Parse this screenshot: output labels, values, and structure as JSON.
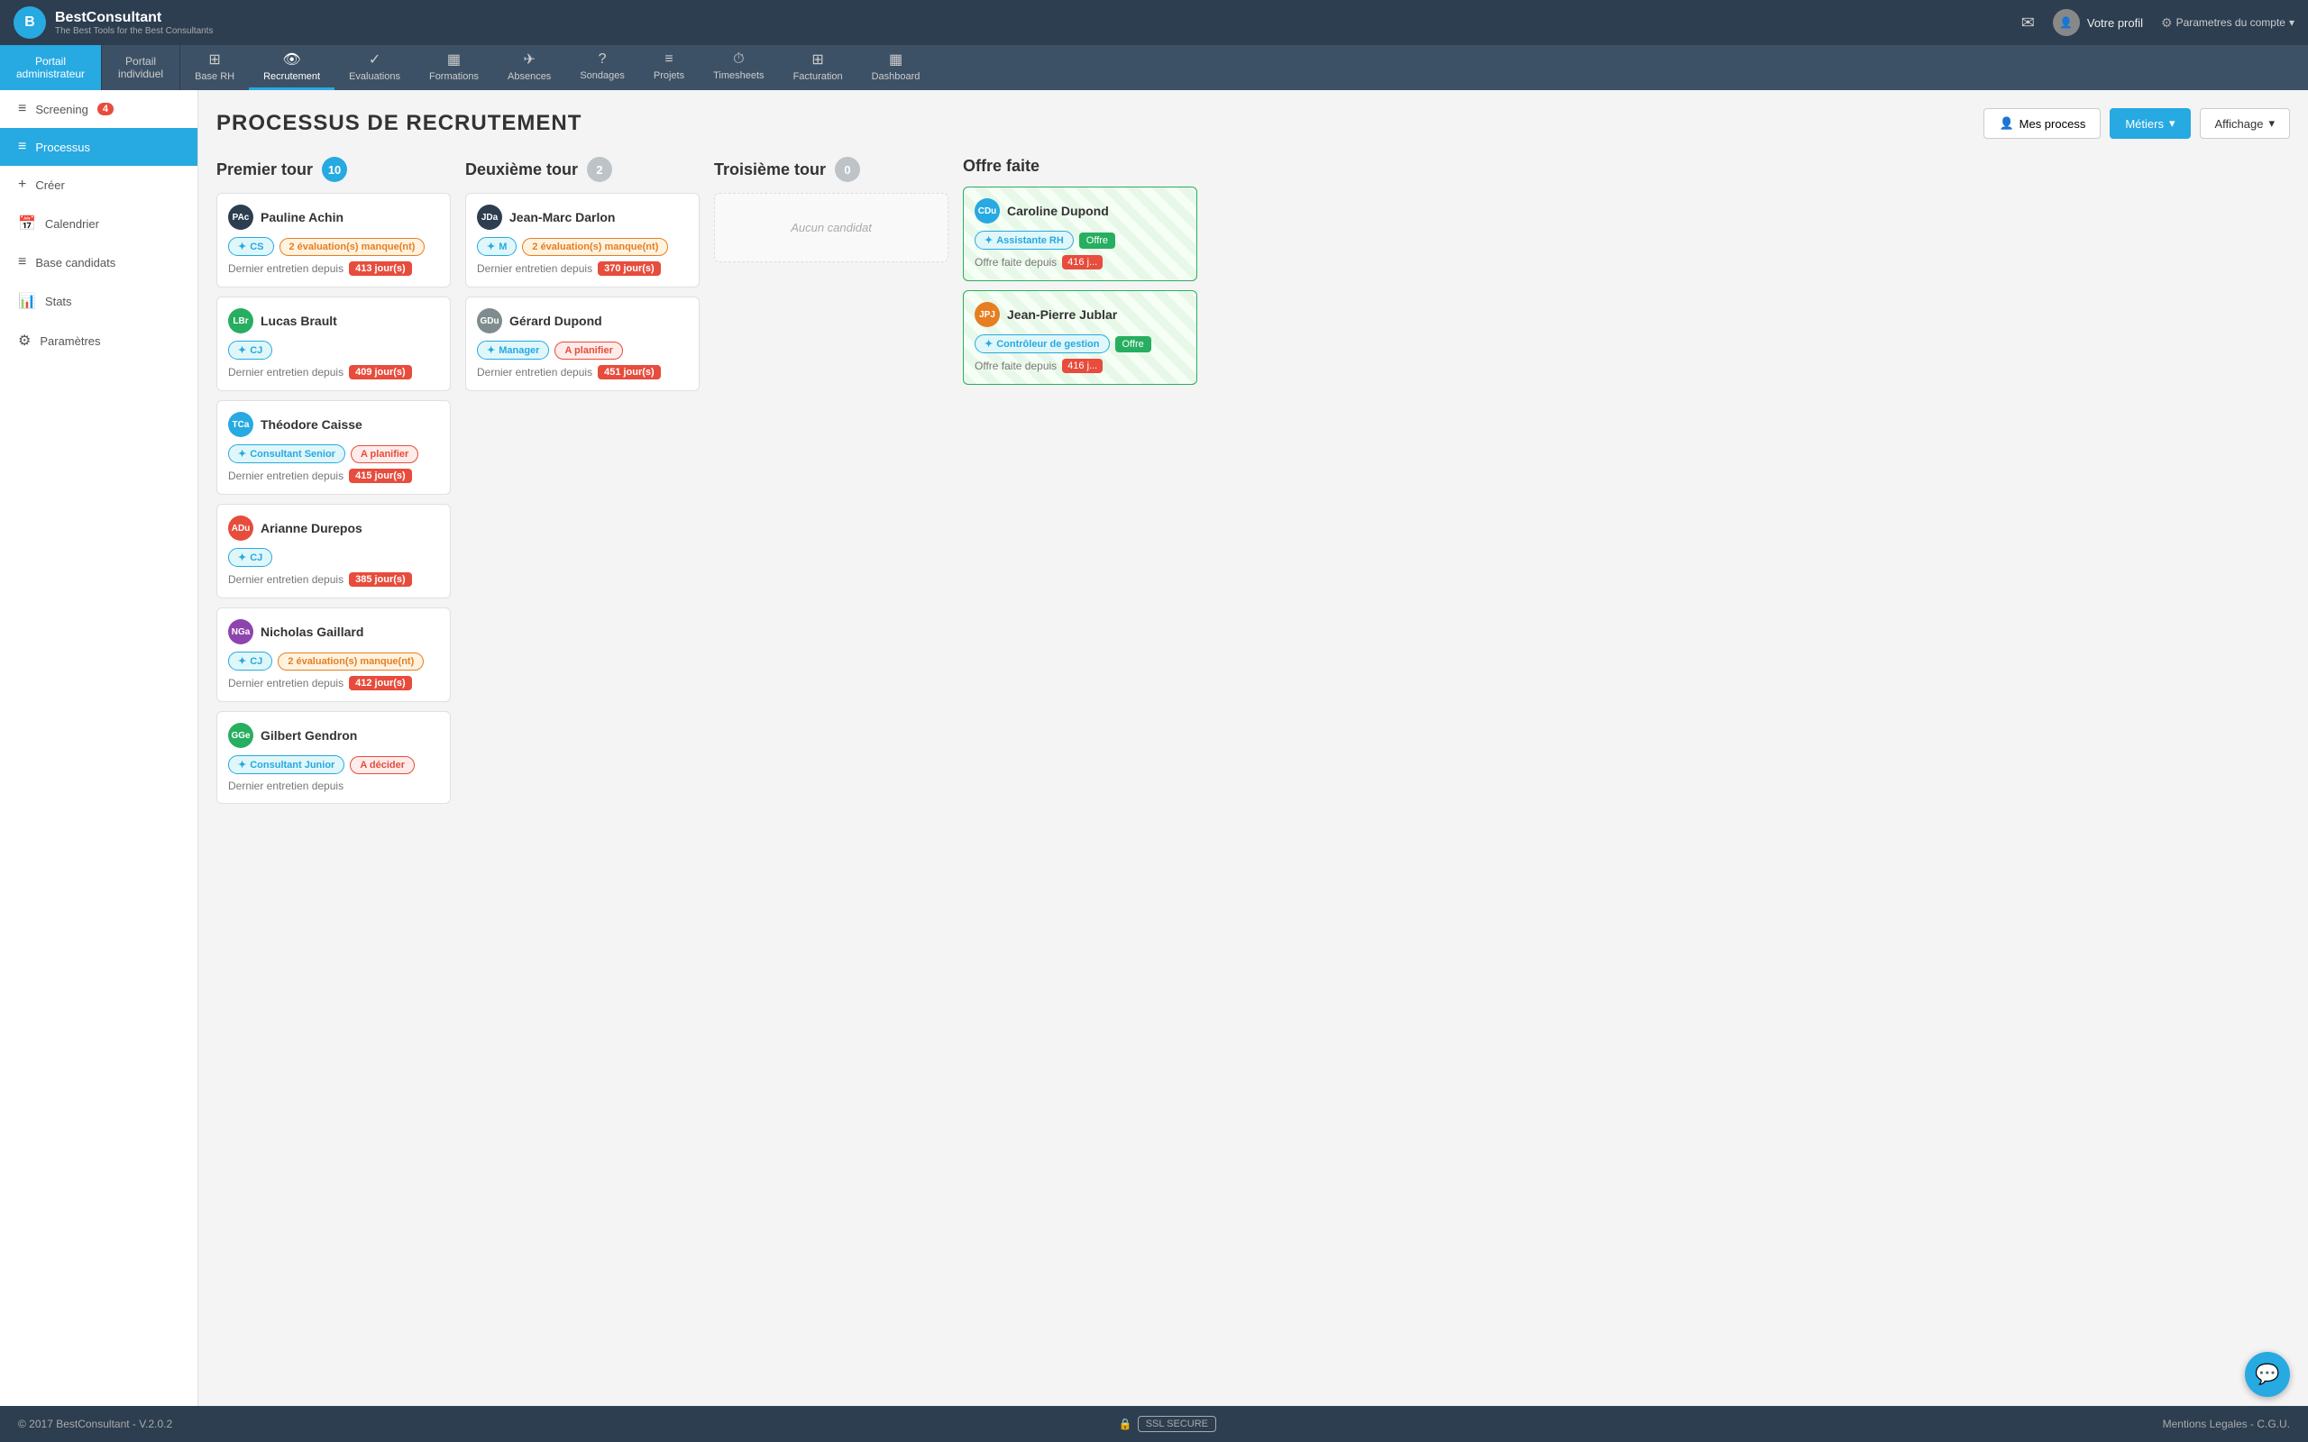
{
  "header": {
    "logo_letter": "B",
    "brand_name": "BestConsultant",
    "brand_sub": "The Best Tools for the Best Consultants",
    "profile_label": "Votre profil",
    "settings_label": "Parametres du compte"
  },
  "nav_portals": [
    {
      "id": "admin",
      "label": "Portail\nadministrateur",
      "active": true
    },
    {
      "id": "indiv",
      "label": "Portail\nindividuel",
      "active": false
    }
  ],
  "nav_items": [
    {
      "id": "base-rh",
      "icon": "⊞",
      "label": "Base RH",
      "active": false
    },
    {
      "id": "recrutement",
      "icon": "👁",
      "label": "Recrutement",
      "active": true
    },
    {
      "id": "evaluations",
      "icon": "✓",
      "label": "Evaluations",
      "active": false
    },
    {
      "id": "formations",
      "icon": "▦",
      "label": "Formations",
      "active": false
    },
    {
      "id": "absences",
      "icon": "✈",
      "label": "Absences",
      "active": false
    },
    {
      "id": "sondages",
      "icon": "?",
      "label": "Sondages",
      "active": false
    },
    {
      "id": "projets",
      "icon": "≡",
      "label": "Projets",
      "active": false
    },
    {
      "id": "timesheets",
      "icon": "⏱",
      "label": "Timesheets",
      "active": false
    },
    {
      "id": "facturation",
      "icon": "⊞",
      "label": "Facturation",
      "active": false
    },
    {
      "id": "dashboard",
      "icon": "▦",
      "label": "Dashboard",
      "active": false
    }
  ],
  "sidebar": {
    "items": [
      {
        "id": "screening",
        "icon": "≡",
        "label": "Screening",
        "badge": "4",
        "active": false
      },
      {
        "id": "processus",
        "icon": "≡",
        "label": "Processus",
        "badge": null,
        "active": true
      },
      {
        "id": "creer",
        "icon": "+",
        "label": "Créer",
        "badge": null,
        "active": false
      },
      {
        "id": "calendrier",
        "icon": "📅",
        "label": "Calendrier",
        "badge": null,
        "active": false
      },
      {
        "id": "base-candidats",
        "icon": "≡",
        "label": "Base candidats",
        "badge": null,
        "active": false
      },
      {
        "id": "stats",
        "icon": "📊",
        "label": "Stats",
        "badge": null,
        "active": false
      },
      {
        "id": "parametres",
        "icon": "⚙",
        "label": "Paramètres",
        "badge": null,
        "active": false
      }
    ]
  },
  "page": {
    "title": "PROCESSUS DE RECRUTEMENT",
    "actions": {
      "mes_process": "Mes process",
      "metiers": "Métiers",
      "affichage": "Affichage"
    }
  },
  "columns": [
    {
      "id": "premier-tour",
      "title": "Premier tour",
      "count": "10",
      "cards": [
        {
          "name": "Pauline Achin",
          "initials": "PAc",
          "avatar_color": "#2c3e50",
          "tags": [
            {
              "type": "cyan",
              "icon": "✦",
              "label": "CS"
            },
            {
              "type": "orange",
              "label": "2 évaluation(s) manque(nt)"
            }
          ],
          "entretien": "Dernier entretien depuis",
          "days": "413 jour(s)"
        },
        {
          "name": "Lucas Brault",
          "initials": "LBr",
          "avatar_color": "#27ae60",
          "tags": [
            {
              "type": "cyan",
              "icon": "✦",
              "label": "CJ"
            }
          ],
          "entretien": "Dernier entretien depuis",
          "days": "409 jour(s)"
        },
        {
          "name": "Théodore Caisse",
          "initials": "TCa",
          "avatar_color": "#27a9e1",
          "tags": [
            {
              "type": "cyan",
              "icon": "✦",
              "label": "Consultant Senior"
            },
            {
              "type": "red",
              "label": "A planifier"
            }
          ],
          "entretien": "Dernier entretien depuis",
          "days": "415 jour(s)"
        },
        {
          "name": "Arianne Durepos",
          "initials": "ADu",
          "avatar_color": "#e74c3c",
          "tags": [
            {
              "type": "cyan",
              "icon": "✦",
              "label": "CJ"
            }
          ],
          "entretien": "Dernier entretien depuis",
          "days": "385 jour(s)"
        },
        {
          "name": "Nicholas Gaillard",
          "initials": "NGa",
          "avatar_color": "#8e44ad",
          "tags": [
            {
              "type": "cyan",
              "icon": "✦",
              "label": "CJ"
            },
            {
              "type": "orange",
              "label": "2 évaluation(s) manque(nt)"
            }
          ],
          "entretien": "Dernier entretien depuis",
          "days": "412 jour(s)"
        },
        {
          "name": "Gilbert Gendron",
          "initials": "GGe",
          "avatar_color": "#27ae60",
          "tags": [
            {
              "type": "cyan",
              "icon": "✦",
              "label": "Consultant Junior"
            },
            {
              "type": "red",
              "label": "A décider"
            }
          ],
          "entretien": "Dernier entretien depuis",
          "days": "..."
        }
      ]
    },
    {
      "id": "deuxieme-tour",
      "title": "Deuxième tour",
      "count": "2",
      "cards": [
        {
          "name": "Jean-Marc Darlon",
          "initials": "JDa",
          "avatar_color": "#2c3e50",
          "tags": [
            {
              "type": "cyan",
              "icon": "✦",
              "label": "M"
            },
            {
              "type": "orange",
              "label": "2 évaluation(s) manque(nt)"
            }
          ],
          "entretien": "Dernier entretien depuis",
          "days": "370 jour(s)"
        },
        {
          "name": "Gérard Dupond",
          "initials": "GDu",
          "avatar_color": "#7f8c8d",
          "tags": [
            {
              "type": "cyan",
              "icon": "✦",
              "label": "Manager"
            },
            {
              "type": "red",
              "label": "A planifier"
            }
          ],
          "entretien": "Dernier entretien depuis",
          "days": "451 jour(s)"
        }
      ]
    },
    {
      "id": "troisieme-tour",
      "title": "Troisième tour",
      "count": "0",
      "cards": [],
      "empty_label": "Aucun candidat"
    },
    {
      "id": "offre-faite",
      "title": "Offre faite",
      "count": null,
      "cards": [
        {
          "name": "Caroline Dupond",
          "initials": "CDu",
          "avatar_color": "#27a9e1",
          "tag_role": "Assistante RH",
          "tag_offre": "Offre",
          "offre_label": "Offre faite depuis",
          "offre_days": "416 j..."
        },
        {
          "name": "Jean-Pierre Jublar",
          "initials": "JPJ",
          "avatar_color": "#e67e22",
          "tag_role": "Contrôleur de gestion",
          "tag_offre": "Offre",
          "offre_label": "Offre faite depuis",
          "offre_days": "416 j..."
        }
      ]
    }
  ],
  "footer": {
    "copyright": "© 2017 BestConsultant - V.2.0.2",
    "ssl_label": "SSL SECURE",
    "mentions": "Mentions Legales - C.G.U."
  }
}
